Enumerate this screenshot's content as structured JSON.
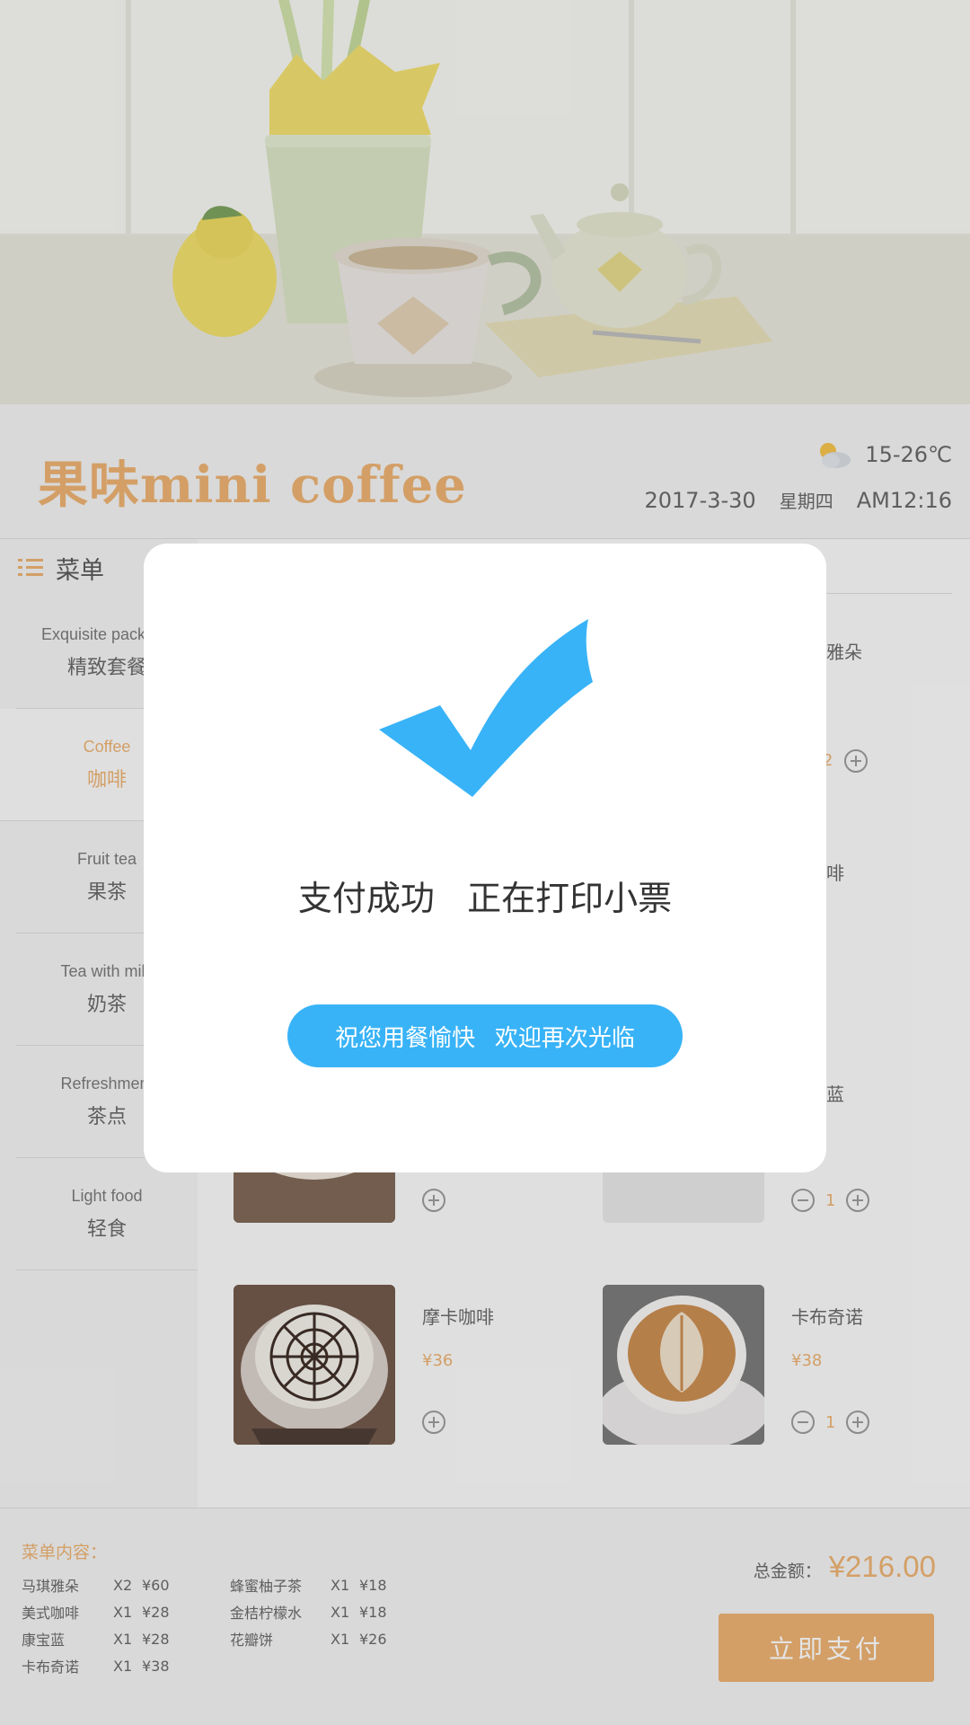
{
  "header": {
    "brand": "果味mini coffee",
    "weather_icon": "partly-cloudy-icon",
    "temperature": "15-26℃",
    "date": "2017-3-30",
    "weekday": "星期四",
    "time": "AM12:16"
  },
  "sidebar": {
    "title": "菜单",
    "categories": [
      {
        "en": "Exquisite package",
        "zh": "精致套餐",
        "active": false
      },
      {
        "en": "Coffee",
        "zh": "咖啡",
        "active": true
      },
      {
        "en": "Fruit tea",
        "zh": "果茶",
        "active": false
      },
      {
        "en": "Tea with milk",
        "zh": "奶茶",
        "active": false
      },
      {
        "en": "Refreshment",
        "zh": "茶点",
        "active": false
      },
      {
        "en": "Light food",
        "zh": "轻食",
        "active": false
      }
    ]
  },
  "products": {
    "peek": [
      "雅朵",
      "2",
      "啡",
      "蓝"
    ],
    "row3_right_qty": "1",
    "mocha": {
      "name": "摩卡咖啡",
      "price": "¥36"
    },
    "cappuccino": {
      "name": "卡布奇诺",
      "price": "¥38",
      "qty": "1"
    }
  },
  "order": {
    "title": "菜单内容：",
    "left": [
      {
        "name": "马琪雅朵",
        "qty": "X2",
        "price": "¥60"
      },
      {
        "name": "美式咖啡",
        "qty": "X1",
        "price": "¥28"
      },
      {
        "name": "康宝蓝",
        "qty": "X1",
        "price": "¥28"
      },
      {
        "name": "卡布奇诺",
        "qty": "X1",
        "price": "¥38"
      }
    ],
    "right": [
      {
        "name": "蜂蜜柚子茶",
        "qty": "X1",
        "price": "¥18"
      },
      {
        "name": "金桔柠檬水",
        "qty": "X1",
        "price": "¥18"
      },
      {
        "name": "花瓣饼",
        "qty": "X1",
        "price": "¥26"
      }
    ],
    "total_label": "总金额：",
    "total_amount": "¥216.00",
    "pay_label": "立即支付"
  },
  "modal": {
    "icon": "checkmark-icon",
    "message": "支付成功   正在打印小票",
    "button_label": "祝您用餐愉快   欢迎再次光临",
    "accent_color": "#39b3f7"
  },
  "colors": {
    "brand": "#ecb06f",
    "accent": "#39b3f7"
  }
}
